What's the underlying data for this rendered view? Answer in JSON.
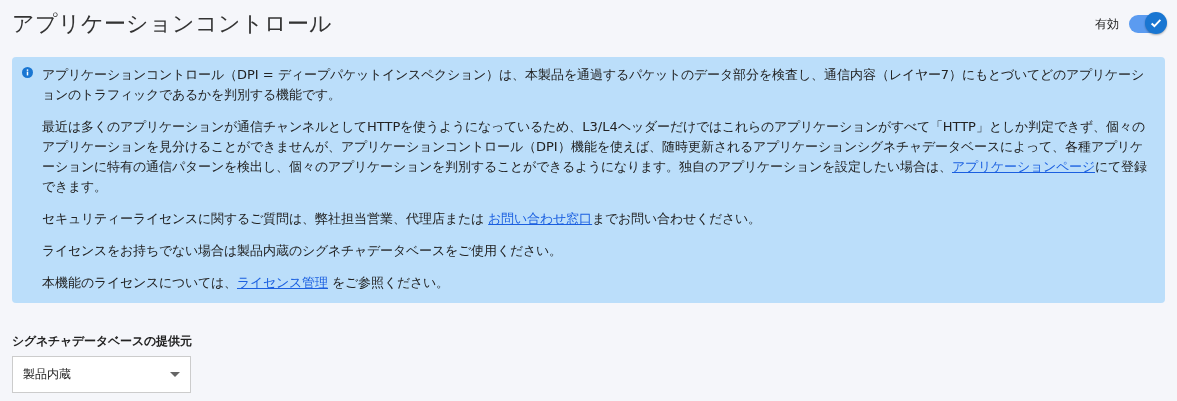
{
  "title": "アプリケーションコントロール",
  "toggle": {
    "label": "有効",
    "on": true
  },
  "info": {
    "paragraphs": [
      [
        {
          "kind": "text",
          "text": "アプリケーションコントロール（DPI = ディープパケットインスペクション）は、本製品を通過するパケットのデータ部分を検査し、通信内容（レイヤー7）にもとづいてどのアプリケーションのトラフィックであるかを判別する機能です。"
        }
      ],
      [
        {
          "kind": "text",
          "text": "最近は多くのアプリケーションが通信チャンネルとしてHTTPを使うようになっているため、L3/L4ヘッダーだけではこれらのアプリケーションがすべて「HTTP」としか判定できず、個々のアプリケーションを見分けることができませんが、アプリケーションコントロール（DPI）機能を使えば、随時更新されるアプリケーションシグネチャデータベースによって、各種アプリケーションに特有の通信パターンを検出し、個々のアプリケーションを判別することができるようになります。独自のアプリケーションを設定したい場合は、"
        },
        {
          "kind": "link",
          "text": "アプリケーションページ"
        },
        {
          "kind": "text",
          "text": "にて登録できます。"
        }
      ],
      [
        {
          "kind": "text",
          "text": "セキュリティーライセンスに関するご質問は、弊社担当営業、代理店または "
        },
        {
          "kind": "link",
          "text": "お問い合わせ窓口"
        },
        {
          "kind": "text",
          "text": "までお問い合わせください。"
        }
      ],
      [
        {
          "kind": "text",
          "text": "ライセンスをお持ちでない場合は製品内蔵のシグネチャデータベースをご使用ください。"
        }
      ],
      [
        {
          "kind": "text",
          "text": "本機能のライセンスについては、"
        },
        {
          "kind": "link",
          "text": "ライセンス管理"
        },
        {
          "kind": "text",
          "text": " をご参照ください。"
        }
      ]
    ]
  },
  "field": {
    "label": "シグネチャデータベースの提供元",
    "value": "製品内蔵"
  }
}
